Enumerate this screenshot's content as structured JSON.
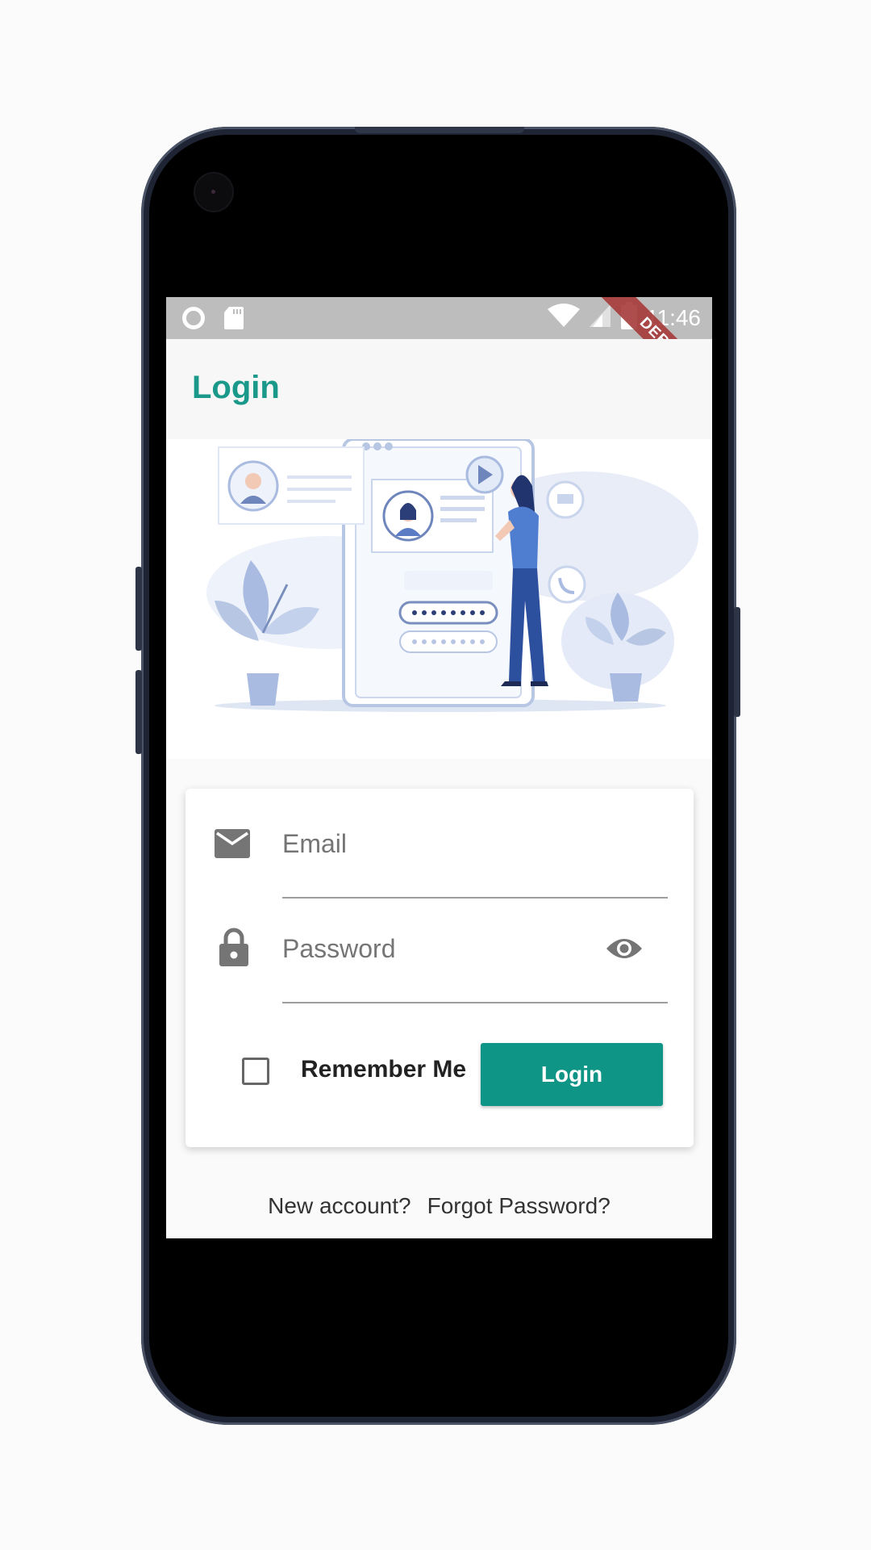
{
  "status_bar": {
    "time": "11:46",
    "debug_label": "DEBUG",
    "icons": [
      "record-icon",
      "sd-card-icon",
      "wifi-icon",
      "signal-icon",
      "battery-icon"
    ]
  },
  "app_bar": {
    "title": "Login"
  },
  "form": {
    "email_placeholder": "Email",
    "password_placeholder": "Password",
    "remember_label": "Remember Me",
    "remember_checked": false,
    "login_label": "Login"
  },
  "footer": {
    "new_account": "New account?",
    "forgot_password": "Forgot Password?"
  },
  "colors": {
    "accent": "#1a998a",
    "button": "#0f9585",
    "status_bar": "#bdbdbd",
    "debug_ribbon": "#a63a3a"
  }
}
